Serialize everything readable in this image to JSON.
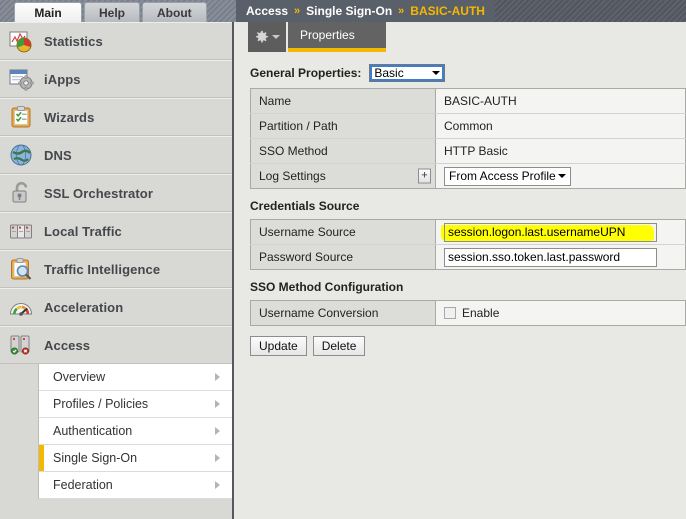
{
  "top_tabs": [
    {
      "label": "Main",
      "active": true
    },
    {
      "label": "Help",
      "active": false
    },
    {
      "label": "About",
      "active": false
    }
  ],
  "sidebar": {
    "items": [
      {
        "label": "Statistics",
        "icon": "statistics-chart-icon"
      },
      {
        "label": "iApps",
        "icon": "iapps-window-gear-icon"
      },
      {
        "label": "Wizards",
        "icon": "wizards-clipboard-icon"
      },
      {
        "label": "DNS",
        "icon": "dns-globe-icon"
      },
      {
        "label": "SSL Orchestrator",
        "icon": "ssl-padlock-icon"
      },
      {
        "label": "Local Traffic",
        "icon": "local-traffic-servers-icon"
      },
      {
        "label": "Traffic Intelligence",
        "icon": "traffic-intelligence-magnifier-icon"
      },
      {
        "label": "Acceleration",
        "icon": "acceleration-gauge-icon"
      },
      {
        "label": "Access",
        "icon": "access-servers-icon"
      }
    ],
    "submenu": [
      {
        "label": "Overview",
        "selected": false
      },
      {
        "label": "Profiles / Policies",
        "selected": false
      },
      {
        "label": "Authentication",
        "selected": false
      },
      {
        "label": "Single Sign-On",
        "selected": true
      },
      {
        "label": "Federation",
        "selected": false
      }
    ]
  },
  "breadcrumb": {
    "root": "Access",
    "sep": "»",
    "middle": "Single Sign-On",
    "current": "BASIC-AUTH"
  },
  "tabrow": {
    "gear_icon": "gear-icon",
    "properties_label": "Properties"
  },
  "general_properties": {
    "heading": "General Properties:",
    "mode_select": "Basic",
    "rows": [
      {
        "label": "Name",
        "value": "BASIC-AUTH",
        "type": "text"
      },
      {
        "label": "Partition / Path",
        "value": "Common",
        "type": "text"
      },
      {
        "label": "SSO Method",
        "value": "HTTP Basic",
        "type": "text"
      },
      {
        "label": "Log Settings",
        "value": "From Access Profile",
        "type": "dropdown",
        "plus": "+"
      }
    ]
  },
  "credentials_source": {
    "heading": "Credentials Source",
    "rows": [
      {
        "label": "Username Source",
        "value": "session.logon.last.usernameUPN",
        "highlight": true
      },
      {
        "label": "Password Source",
        "value": "session.sso.token.last.password",
        "highlight": false
      }
    ]
  },
  "sso_method_configuration": {
    "heading": "SSO Method Configuration",
    "rows": [
      {
        "label": "Username Conversion",
        "checkbox_label": "Enable",
        "checked": false
      }
    ]
  },
  "buttons": [
    {
      "label": "Update"
    },
    {
      "label": "Delete"
    }
  ],
  "colors": {
    "accent_gold": "#f5b800",
    "highlight_yellow": "#ffff00",
    "header_dark": "#5a6069",
    "content_bg": "#e8e8e4"
  }
}
